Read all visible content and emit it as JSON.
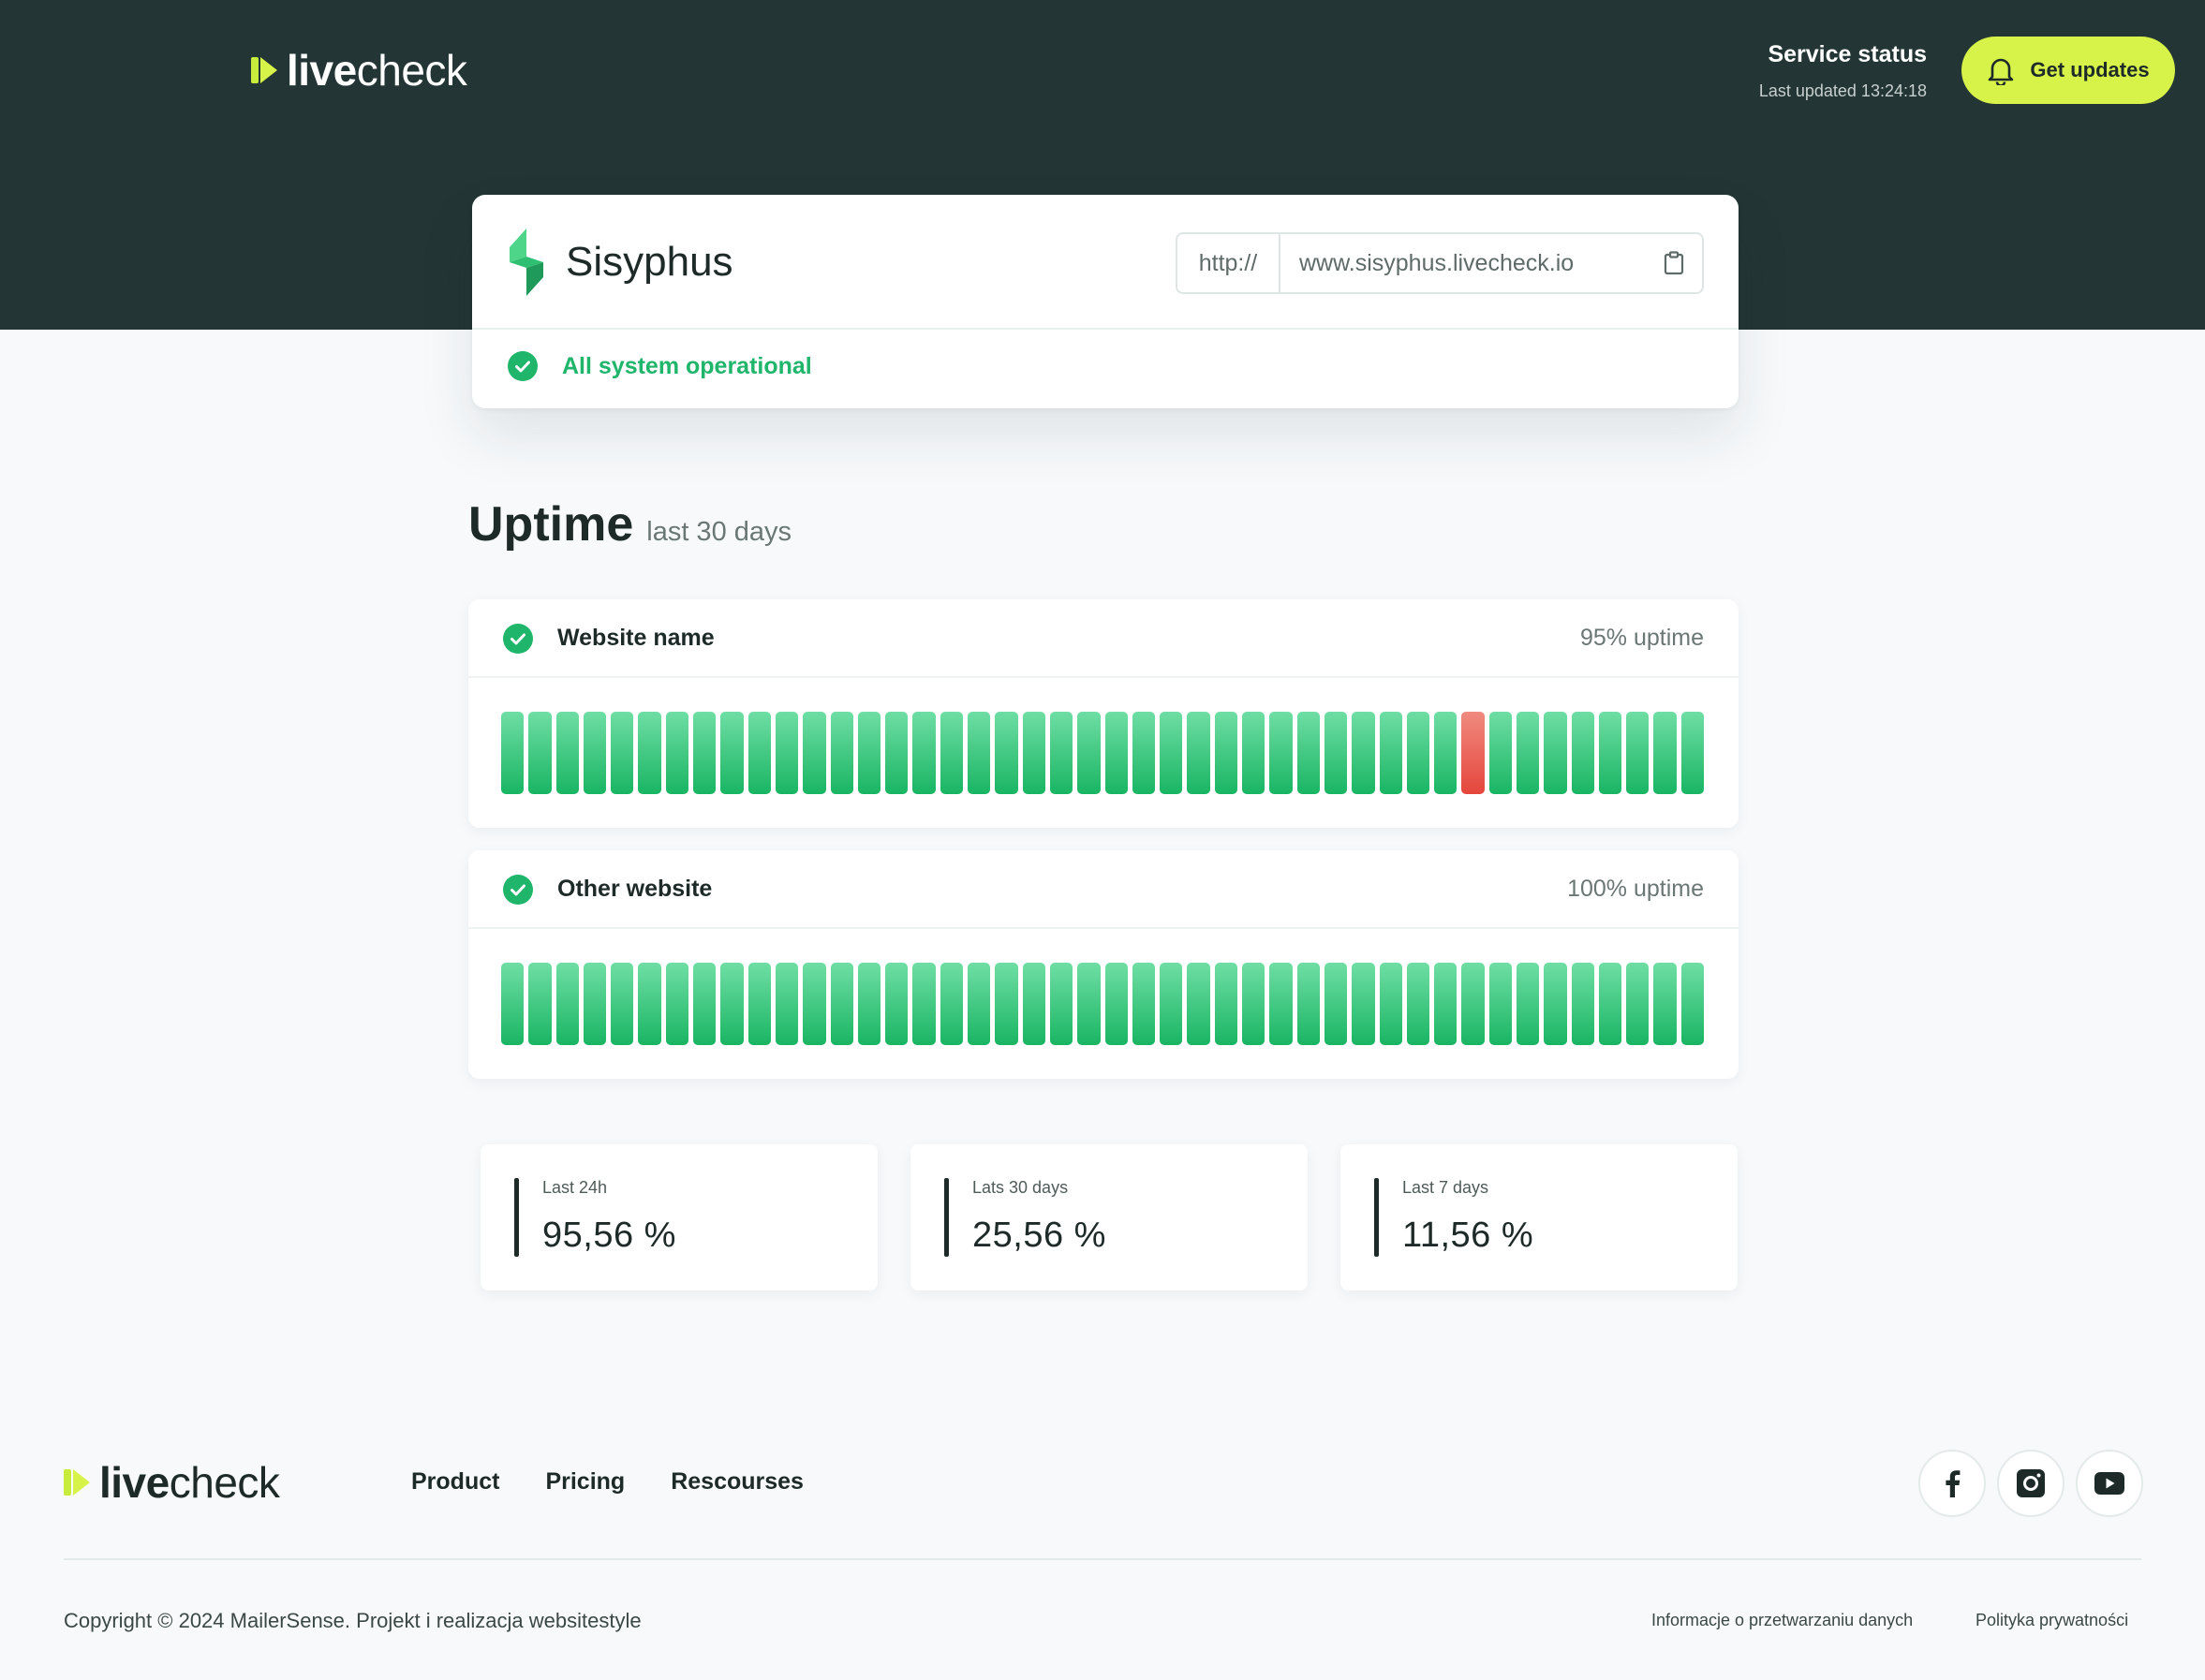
{
  "header": {
    "logo_bold": "live",
    "logo_light": "check",
    "status_title": "Service status",
    "status_updated": "Last updated 13:24:18",
    "updates_button": "Get updates",
    "accent": "#d7f34a",
    "background": "#233534"
  },
  "service": {
    "name": "Sisyphus",
    "url_prefix": "http://",
    "url": "www.sisyphus.livecheck.io",
    "status": "All system operational",
    "status_color": "#1fb56a"
  },
  "uptime": {
    "title": "Uptime",
    "subtitle": "last 30 days",
    "sites": [
      {
        "name": "Website name",
        "uptime": "95% uptime",
        "days": [
          "up",
          "up",
          "up",
          "up",
          "up",
          "up",
          "up",
          "up",
          "up",
          "up",
          "up",
          "up",
          "up",
          "up",
          "up",
          "up",
          "up",
          "up",
          "up",
          "up",
          "up",
          "up",
          "up",
          "up",
          "up",
          "up",
          "up",
          "up",
          "up",
          "up",
          "up",
          "up",
          "up",
          "up",
          "up",
          "down",
          "up",
          "up",
          "up",
          "up",
          "up",
          "up",
          "up",
          "up"
        ]
      },
      {
        "name": "Other website",
        "uptime": "100% uptime",
        "days": [
          "up",
          "up",
          "up",
          "up",
          "up",
          "up",
          "up",
          "up",
          "up",
          "up",
          "up",
          "up",
          "up",
          "up",
          "up",
          "up",
          "up",
          "up",
          "up",
          "up",
          "up",
          "up",
          "up",
          "up",
          "up",
          "up",
          "up",
          "up",
          "up",
          "up",
          "up",
          "up",
          "up",
          "up",
          "up",
          "up",
          "up",
          "up",
          "up",
          "up",
          "up",
          "up",
          "up",
          "up"
        ]
      }
    ]
  },
  "stats": [
    {
      "label": "Last 24h",
      "value": "95,56 %"
    },
    {
      "label": "Lats 30 days",
      "value": "25,56 %"
    },
    {
      "label": "Last 7 days",
      "value": "11,56 %"
    }
  ],
  "footer": {
    "nav": [
      "Product",
      "Pricing",
      "Rescourses"
    ],
    "social": [
      "facebook-icon",
      "instagram-icon",
      "youtube-icon"
    ],
    "copyright": "Copyright © 2024 MailerSense. Projekt i realizacja websitestyle",
    "legal_links": [
      "Informacje o przetwarzaniu danych",
      "Polityka prywatności"
    ]
  }
}
